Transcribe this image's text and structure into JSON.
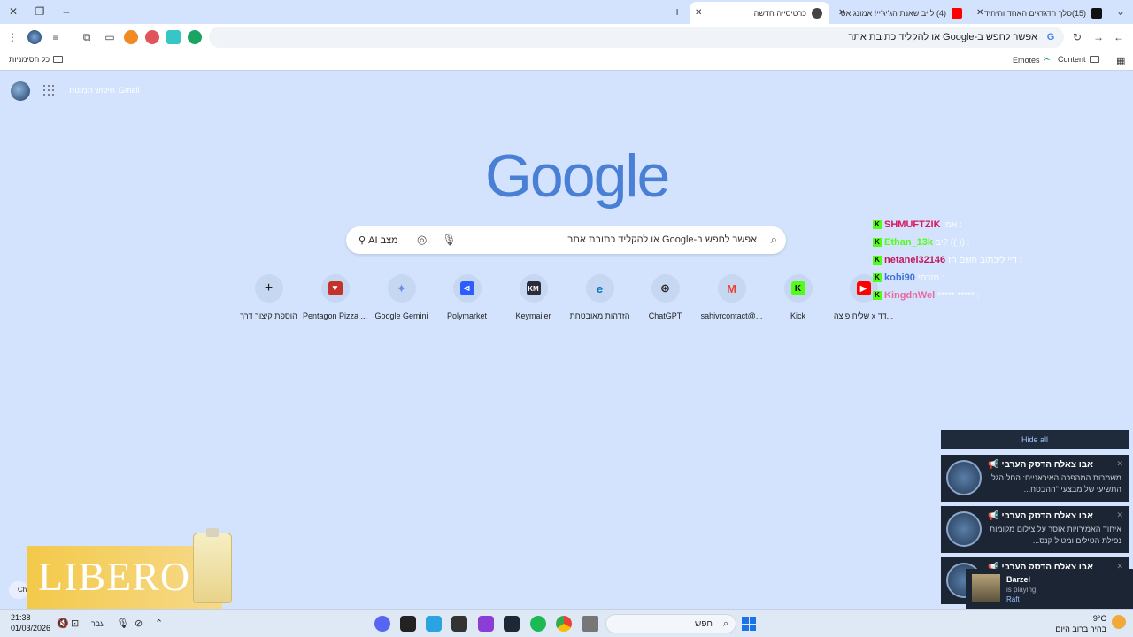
{
  "tabs": [
    {
      "title": "(15)סלך הדגדגים האחד והיחיד",
      "active": false
    },
    {
      "title": "(4) לייב שאנת הג'יג'יי! אמונג אס",
      "active": false
    },
    {
      "title": "כרטיסייה חדשה",
      "active": true
    }
  ],
  "omnibox": {
    "placeholder": "אפשר לחפש ב-Google או להקליד כתובת אתר"
  },
  "bookmarks": {
    "all_bookmarks": "כל הסימניות",
    "emotes": "Emotes",
    "content": "Content"
  },
  "header": {
    "gmail": "Gmail",
    "images": "חיפוש תמונות"
  },
  "logo": "Google",
  "search": {
    "placeholder": "אפשר לחפש ב-Google או להקליד כתובת אתר",
    "ai_mode": "מצב AI"
  },
  "shortcuts": [
    {
      "label": "שליח פיצה x דד...",
      "icon": "youtube-icon",
      "color": "#ff0000"
    },
    {
      "label": "Kick",
      "icon": "kick-icon",
      "color": "#53fc18"
    },
    {
      "label": "sahivrcontact@...",
      "icon": "gmail-icon",
      "color": "#ea4335"
    },
    {
      "label": "ChatGPT",
      "icon": "chatgpt-icon",
      "color": "#222222"
    },
    {
      "label": "הזדהות מאובטחת",
      "icon": "edge-icon",
      "color": "#0a74c5"
    },
    {
      "label": "Keymailer",
      "icon": "keymailer-icon",
      "color": "#2b2b3a"
    },
    {
      "label": "Polymarket",
      "icon": "polymarket-icon",
      "color": "#2e5cff"
    },
    {
      "label": "Google Gemini",
      "icon": "gemini-icon",
      "color": "#6d8cf2"
    },
    {
      "label": "Pentagon Pizza ...",
      "icon": "pizza-icon",
      "color": "#c4332b"
    },
    {
      "label": "הוספת קיצור דרך",
      "icon": "plus-icon",
      "color": "#1f1f1f"
    }
  ],
  "chat": [
    {
      "user": "SHMUFTZIK",
      "msg": ": אמי",
      "color": "#d81b60"
    },
    {
      "user": "Ethan_13k",
      "msg": ": (( )) ?יב",
      "color": "#53fc18"
    },
    {
      "user": "netanel32146",
      "msg": ": דיי ליכתוב חשם הז",
      "color": "#c2185b"
    },
    {
      "user": "kobi90",
      "msg": ": חזרתי",
      "color": "#3f6fd8"
    },
    {
      "user": "KingdnWel",
      "msg": ": ***** *****",
      "color": "#e86aa0"
    }
  ],
  "notifications": {
    "hide_all": "Hide all",
    "items": [
      {
        "title": "אבו צאלח הדסק הערבי 📢",
        "body": "משמרות המהפכה האיראניים: החל הגל התשיעי של מבצעי \"ההבטח..."
      },
      {
        "title": "אבו צאלח הדסק הערבי 📢",
        "body": "איחוד האמירויות אוסר על צילום מקומות נפילת הטילים ומטיל קנס..."
      },
      {
        "title": "אבו צאלח הדסק הערבי 📢",
        "body": ""
      }
    ]
  },
  "now_playing": {
    "name": "Barzel",
    "status": "is playing",
    "game": "Raft"
  },
  "ad": {
    "brand": "LIBERO"
  },
  "taskbar": {
    "time": "21:38",
    "date": "01/03/2026",
    "lang": "עבר",
    "search": "חפש",
    "weather_temp": "9°C",
    "weather_desc": "בהיר ברוב היום"
  },
  "chat_bubble": "Ch"
}
